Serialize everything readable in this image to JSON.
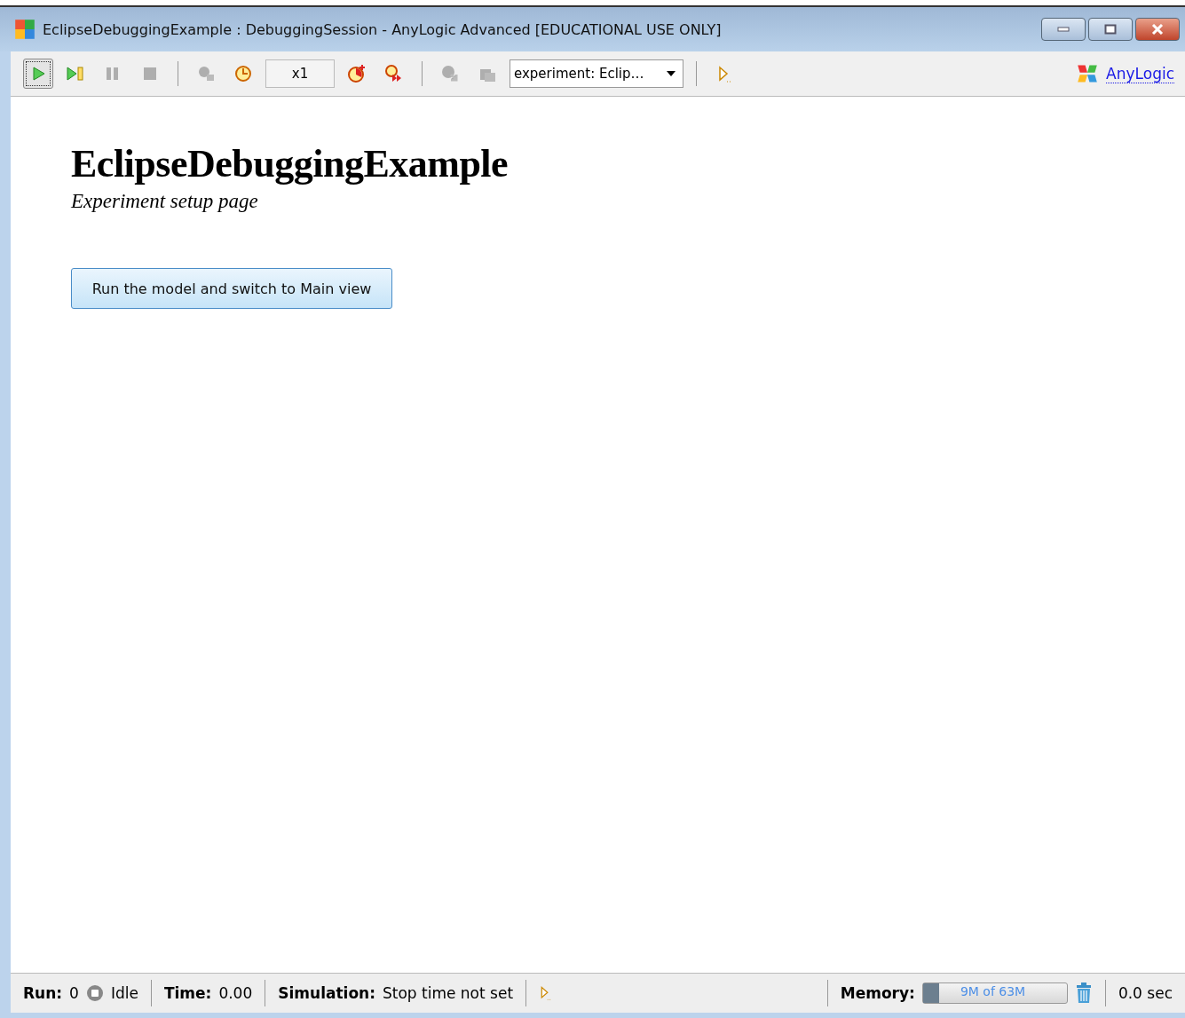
{
  "window": {
    "title": "EclipseDebuggingExample : DebuggingSession - AnyLogic Advanced [EDUCATIONAL USE ONLY]"
  },
  "toolbar": [
    {
      "kind": "run",
      "pressed": true,
      "disabled": false
    },
    {
      "kind": "step",
      "pressed": false,
      "disabled": false
    },
    {
      "kind": "pause",
      "pressed": false,
      "disabled": true
    },
    {
      "kind": "stop",
      "pressed": false,
      "disabled": true
    },
    {
      "kind": "separator"
    },
    {
      "kind": "slower",
      "pressed": false,
      "disabled": true
    },
    {
      "kind": "realtime",
      "pressed": false,
      "disabled": false
    },
    {
      "kind": "speed",
      "text": "x1"
    },
    {
      "kind": "faster",
      "pressed": false,
      "disabled": false
    },
    {
      "kind": "fastforward",
      "pressed": false,
      "disabled": false
    },
    {
      "kind": "separator"
    },
    {
      "kind": "back",
      "pressed": false,
      "disabled": true
    },
    {
      "kind": "up",
      "pressed": false,
      "disabled": true
    },
    {
      "kind": "dropdown",
      "text": "experiment: Eclip…"
    },
    {
      "kind": "separator"
    },
    {
      "kind": "console",
      "pressed": false,
      "disabled": false
    }
  ],
  "brand": {
    "link": "AnyLogic"
  },
  "page": {
    "title": "EclipseDebuggingExample",
    "subtitle": "Experiment setup page",
    "button": "Run the model and switch to Main view"
  },
  "status_bar": {
    "run_label": "Run:",
    "run_value": "0",
    "state": "Idle",
    "time_label": "Time:",
    "time_value": "0.00",
    "simulation_label": "Simulation:",
    "simulation_value": "Stop time not set",
    "memory_label": "Memory:",
    "memory_text": "9M of 63M",
    "memory": {
      "level": 0.11
    },
    "elapsed": "0.0 sec"
  }
}
